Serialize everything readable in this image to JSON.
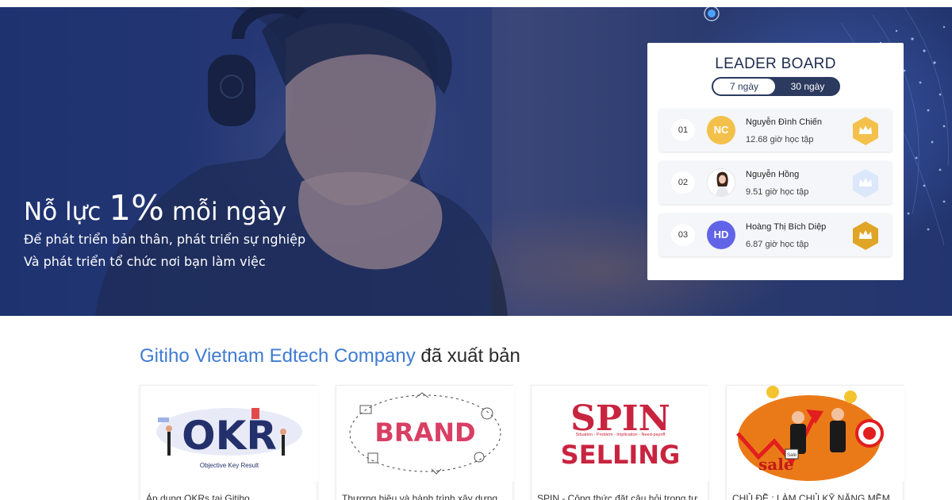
{
  "hero": {
    "title_prefix": "Nỗ lực ",
    "title_highlight": "1%",
    "title_suffix": " mỗi ngày",
    "line1": "Để phát triển bản thân, phát triển sự nghiệp",
    "line2": "Và phát triển tổ chức nơi bạn làm việc"
  },
  "leaderboard": {
    "title": "LEADER BOARD",
    "tabs": [
      "7 ngày",
      "30 ngày"
    ],
    "active_tab": "30 ngày",
    "entries": [
      {
        "rank": "01",
        "initials": "NC",
        "name": "Nguyễn Đình Chiến",
        "hours": "12.68 giờ học tập",
        "avatar_color": "#f3c14b",
        "crown_color": "#f3c14b"
      },
      {
        "rank": "02",
        "initials": "",
        "name": "Nguyễn Hồng",
        "hours": "9.51 giờ học tập",
        "avatar_icon": "user-photo",
        "crown_color": "#dbe7fb"
      },
      {
        "rank": "03",
        "initials": "HD",
        "name": "Hoàng Thị Bích Diệp",
        "hours": "6.87 giờ học tập",
        "avatar_color": "#6264e8",
        "crown_color": "#e0a526"
      }
    ]
  },
  "published": {
    "company": "Gitiho Vietnam Edtech Company",
    "suffix": " đã xuất bản",
    "courses": [
      {
        "title": "Áp dụng OKRs tại Gitiho",
        "thumb_text": "OKR",
        "thumb_caption": "Objective Key Result"
      },
      {
        "title": "Thương hiệu và hành trình xây dựng",
        "thumb_text": "BRAND"
      },
      {
        "title": "SPIN - Công thức đặt câu hỏi trong tư",
        "thumb_text_1": "SPIN",
        "thumb_text_2": "SELLING",
        "thumb_caption": "Situation - Problem - Implication - Need-payoff"
      },
      {
        "title": "CHỦ ĐỀ : LÀM CHỦ KỸ NĂNG MỀM",
        "thumb_text": "sale",
        "thumb_label": "Sale"
      }
    ]
  },
  "colors": {
    "accent": "#3f7bd2",
    "hero_bg": "#23356f",
    "tab_dark": "#2b3a5e"
  }
}
